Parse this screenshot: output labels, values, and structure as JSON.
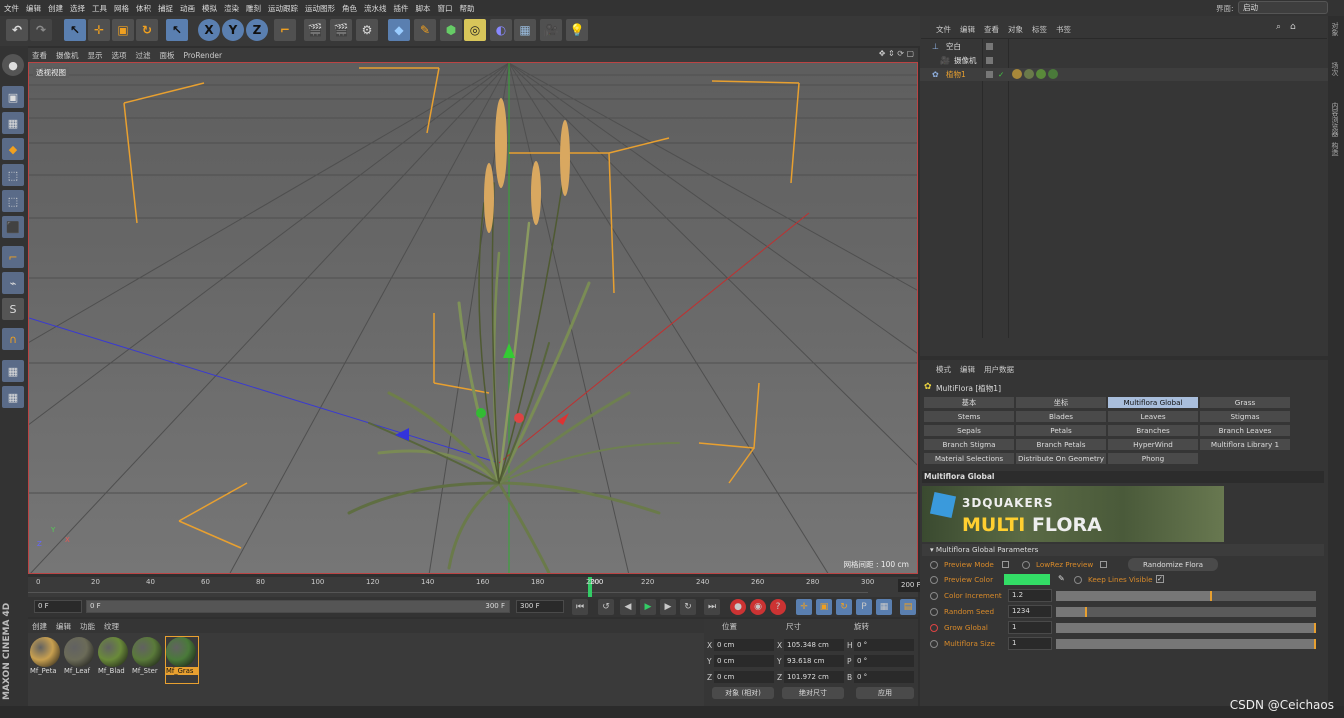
{
  "menu": {
    "items": [
      "文件",
      "编辑",
      "创建",
      "选择",
      "工具",
      "网格",
      "体积",
      "捕捉",
      "动画",
      "模拟",
      "渲染",
      "雕刻",
      "运动跟踪",
      "运动图形",
      "角色",
      "流水线",
      "插件",
      "脚本",
      "窗口",
      "帮助"
    ],
    "layout_label": "界面:",
    "layout_value": "启动"
  },
  "toolbar": {
    "icons": [
      "undo-icon",
      "redo-icon",
      "select-icon",
      "move-icon",
      "scale-icon",
      "rotate-icon",
      "live-select-icon",
      "x-axis-icon",
      "y-axis-icon",
      "z-axis-icon",
      "coord-system-icon",
      "render-view-icon",
      "render-picture-icon",
      "render-settings-icon",
      "cube-icon",
      "pen-icon",
      "subdivision-icon",
      "array-icon",
      "deformer-icon",
      "floor-icon",
      "camera-icon",
      "light-icon"
    ],
    "axis_labels": [
      "X",
      "Y",
      "Z"
    ]
  },
  "viewport": {
    "menu": [
      "查看",
      "摄像机",
      "显示",
      "选项",
      "过滤",
      "面板",
      "ProRender"
    ],
    "label": "透视视图",
    "grid_distance": "网格间距 : 100 cm",
    "axis_labels": [
      "Y",
      "Z",
      "X"
    ]
  },
  "timeline": {
    "ticks": [
      "0",
      "20",
      "40",
      "60",
      "80",
      "100",
      "120",
      "140",
      "160",
      "180",
      "200",
      "220",
      "240",
      "260",
      "280",
      "300"
    ],
    "current_frame": "200",
    "end_field": "200 F",
    "colors": {
      "playhead": "#33cc66"
    }
  },
  "transport": {
    "start_field": "0 F",
    "range_start": "0 F",
    "range_end": "300 F",
    "end_field": "300 F"
  },
  "materials": {
    "tabs": [
      "创建",
      "编辑",
      "功能",
      "纹理"
    ],
    "items": [
      {
        "label": "Mf_Peta",
        "color": "#c8a050"
      },
      {
        "label": "Mf_Leaf",
        "color": "#6b6b58"
      },
      {
        "label": "Mf_Blad",
        "color": "#6a8a3a"
      },
      {
        "label": "Mf_Ster",
        "color": "#5a7a3a"
      },
      {
        "label": "Mf_Gras",
        "color": "#4a7a3a"
      }
    ],
    "selected": "Mf_Gras"
  },
  "coords": {
    "headers": [
      "位置",
      "尺寸",
      "旋转"
    ],
    "rows": [
      {
        "axis": "X",
        "pos": "0 cm",
        "size_axis": "X",
        "size": "105.348 cm",
        "rot_axis": "H",
        "rot": "0 °"
      },
      {
        "axis": "Y",
        "pos": "0 cm",
        "size_axis": "Y",
        "size": "93.618 cm",
        "rot_axis": "P",
        "rot": "0 °"
      },
      {
        "axis": "Z",
        "pos": "0 cm",
        "size_axis": "Z",
        "size": "101.972 cm",
        "rot_axis": "B",
        "rot": "0 °"
      }
    ],
    "mode_select": "对象 (相对)",
    "size_select": "绝对尺寸",
    "apply_label": "应用"
  },
  "brand": "MAXON CINEMA 4D",
  "objects": {
    "menu": [
      "文件",
      "编辑",
      "查看",
      "对象",
      "标签",
      "书签"
    ],
    "rows": [
      {
        "name": "空白",
        "color": "#e0e0e0"
      },
      {
        "name": "摄像机",
        "color": "#e0e0e0"
      },
      {
        "name": "植物1",
        "color": "#e8a030"
      }
    ]
  },
  "attributes": {
    "menu": [
      "模式",
      "编辑",
      "用户数据"
    ],
    "object_title": "MultiFlora [植物1]",
    "tabs": [
      [
        "基本",
        "坐标",
        "Multiflora Global",
        "Grass"
      ],
      [
        "Stems",
        "Blades",
        "Leaves",
        "Stigmas"
      ],
      [
        "Sepals",
        "Petals",
        "Branches",
        "Branch Leaves"
      ],
      [
        "Branch Stigma",
        "Branch Petals",
        "HyperWind",
        "Multiflora Library 1"
      ],
      [
        "Material Selections",
        "Distribute On Geometry",
        "Phong"
      ]
    ],
    "active_tab": "Multiflora Global",
    "section_title": "Multiflora Global",
    "banner_brand": "3DQUAKERS",
    "banner_title_a": "MULTI",
    "banner_title_b": "FLORA",
    "params_title": "Multiflora Global Parameters",
    "preview_mode": "Preview Mode",
    "lowrez_preview": "LowRez Preview",
    "randomize_button": "Randomize Flora",
    "preview_color": "Preview Color",
    "preview_color_value": "#33dd66",
    "keep_lines_visible": "Keep Lines Visible",
    "params": [
      {
        "label": "Color Increment",
        "value": "1.2",
        "fill": 0.6
      },
      {
        "label": "Random Seed",
        "value": "1234",
        "fill": 0.12
      },
      {
        "label": "Grow Global",
        "value": "1",
        "fill": 1.0
      },
      {
        "label": "Multiflora Size",
        "value": "1",
        "fill": 1.0
      }
    ]
  },
  "right_strip": [
    "对象",
    "场次",
    "内容浏览器",
    "构造"
  ],
  "watermark": "CSDN @Ceichaos"
}
